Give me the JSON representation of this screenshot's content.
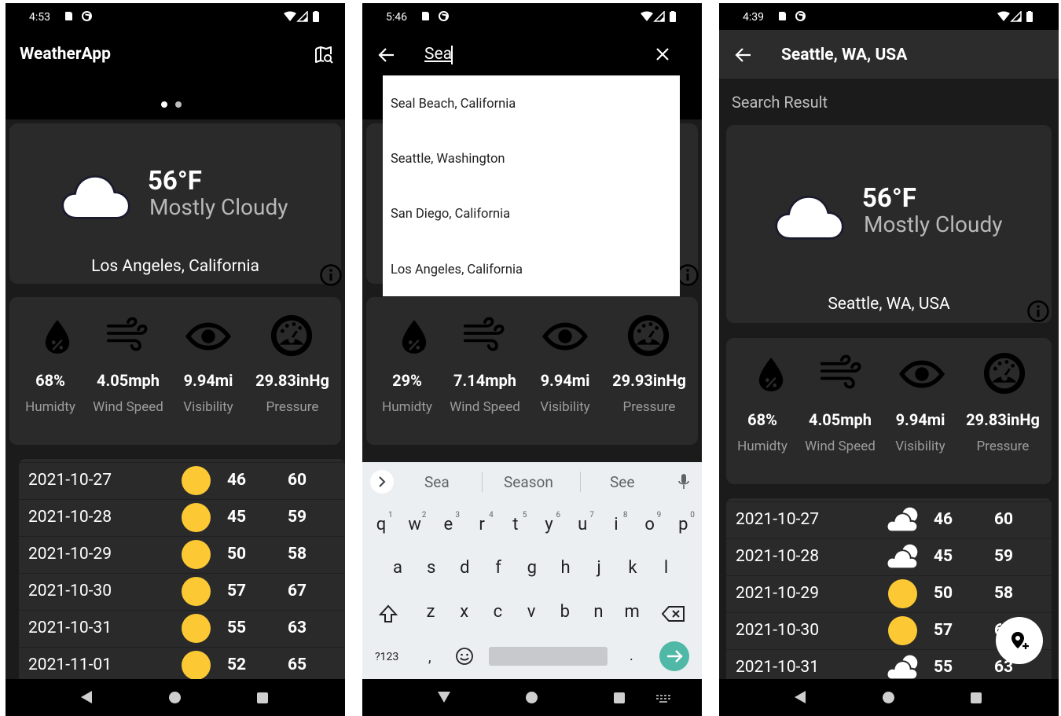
{
  "colors": {
    "background": "#000000",
    "card": "#2a2a2a",
    "sun": "#fcc934",
    "accent_go": "#4fb8a6",
    "keyboard": "#eceff1"
  },
  "screens": [
    {
      "status_time": "4:53",
      "app_title": "WeatherApp",
      "current": {
        "temp": "56°F",
        "condition": "Mostly Cloudy",
        "city": "Los Angeles, California"
      },
      "stats": [
        {
          "value": "68%",
          "label": "Humidty"
        },
        {
          "value": "4.05mph",
          "label": "Wind Speed"
        },
        {
          "value": "9.94mi",
          "label": "Visibility"
        },
        {
          "value": "29.83inHg",
          "label": "Pressure"
        }
      ],
      "forecast": [
        {
          "date": "2021-10-27",
          "low": "46",
          "high": "60",
          "icon": "sun-icon"
        },
        {
          "date": "2021-10-28",
          "low": "45",
          "high": "59",
          "icon": "sun-icon"
        },
        {
          "date": "2021-10-29",
          "low": "50",
          "high": "58",
          "icon": "sun-icon"
        },
        {
          "date": "2021-10-30",
          "low": "57",
          "high": "67",
          "icon": "sun-icon"
        },
        {
          "date": "2021-10-31",
          "low": "55",
          "high": "63",
          "icon": "sun-icon"
        },
        {
          "date": "2021-11-01",
          "low": "52",
          "high": "65",
          "icon": "sun-icon"
        }
      ]
    },
    {
      "status_time": "5:46",
      "search": {
        "query": "Sea",
        "suggestions": [
          "Seal Beach, California",
          "Seattle, Washington",
          "San Diego, California",
          "Los Angeles, California"
        ]
      },
      "stats": [
        {
          "value": "29%",
          "label": "Humidty"
        },
        {
          "value": "7.14mph",
          "label": "Wind Speed"
        },
        {
          "value": "9.94mi",
          "label": "Visibility"
        },
        {
          "value": "29.93inHg",
          "label": "Pressure"
        }
      ],
      "keyboard": {
        "suggestions": [
          "Sea",
          "Season",
          "See"
        ],
        "row1": [
          "q",
          "w",
          "e",
          "r",
          "t",
          "y",
          "u",
          "i",
          "o",
          "p"
        ],
        "row1_nums": [
          "1",
          "2",
          "3",
          "4",
          "5",
          "6",
          "7",
          "8",
          "9",
          "0"
        ],
        "row2": [
          "a",
          "s",
          "d",
          "f",
          "g",
          "h",
          "j",
          "k",
          "l"
        ],
        "row3": [
          "z",
          "x",
          "c",
          "v",
          "b",
          "n",
          "m"
        ],
        "symbols": "?123",
        "comma": ",",
        "period": "."
      }
    },
    {
      "status_time": "4:39",
      "title": "Seattle, WA, USA",
      "subtitle": "Search Result",
      "current": {
        "temp": "56°F",
        "condition": "Mostly Cloudy",
        "city": "Seattle, WA, USA"
      },
      "stats": [
        {
          "value": "68%",
          "label": "Humidty"
        },
        {
          "value": "4.05mph",
          "label": "Wind Speed"
        },
        {
          "value": "9.94mi",
          "label": "Visibility"
        },
        {
          "value": "29.83inHg",
          "label": "Pressure"
        }
      ],
      "forecast": [
        {
          "date": "2021-10-27",
          "low": "46",
          "high": "60",
          "icon": "partly-cloudy-icon"
        },
        {
          "date": "2021-10-28",
          "low": "45",
          "high": "59",
          "icon": "partly-cloudy-icon"
        },
        {
          "date": "2021-10-29",
          "low": "50",
          "high": "58",
          "icon": "sun-icon"
        },
        {
          "date": "2021-10-30",
          "low": "57",
          "high": "6",
          "icon": "sun-icon"
        },
        {
          "date": "2021-10-31",
          "low": "55",
          "high": "63",
          "icon": "partly-cloudy-icon"
        }
      ]
    }
  ]
}
